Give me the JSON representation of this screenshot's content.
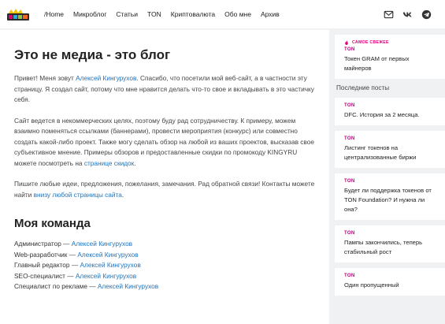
{
  "header": {
    "nav": [
      "/Home",
      "Микроблог",
      "Статьи",
      "TON",
      "Криптовалюта",
      "Обо мне",
      "Архив"
    ],
    "icons": [
      "mail-icon",
      "vk-icon",
      "telegram-icon"
    ]
  },
  "main": {
    "title": "Это не медиа - это блог",
    "para1": {
      "before": "Привет! Меня зовут ",
      "link": "Алексей Кингурухов",
      "after": ". Спасибо, что посетили мой веб-сайт, а в частности эту страницу. Я создал сайт, потому что мне нравится делать что-то свое и вкладывать в это частичку себя."
    },
    "para2": {
      "before": "Сайт ведется в некоммерческих целях, поэтому буду рад сотрудничеству. К примеру, можем взаимно поменяться ссылками (баннерами), провести мероприятия (конкурс) или совместно создать какой-либо проект. Также могу сделать обзор на любой из ваших проектов, высказав свое субъективное мнение. Примеры обзоров и предоставленные скидки по промокоду KINGYRU можете посмотреть на ",
      "link": "странице скидок",
      "after": "."
    },
    "para3": {
      "before": "Пишите любые идеи, предложения, пожелания, замечания. Рад обратной связи! Контакты можете найти ",
      "link": "внизу любой страницы сайта",
      "after": "."
    },
    "team_title": "Моя команда",
    "team": [
      {
        "role": "Администратор",
        "name": "Алексей Кингурухов"
      },
      {
        "role": "Web-разработчик",
        "name": "Алексей Кингурухов"
      },
      {
        "role": "Главный редактор",
        "name": "Алексей Кингурухов"
      },
      {
        "role": "SEO-специалист",
        "name": "Алексей Кингурухов"
      },
      {
        "role": "Специалист по рекламе",
        "name": "Алексей Кингурухов"
      }
    ],
    "dash": " — "
  },
  "sidebar": {
    "featured": {
      "badge": "САМОЕ СВЕЖЕЕ",
      "category": "TON",
      "title": "Токен GRAM от первых майнеров"
    },
    "recent_label": "Последние посты",
    "posts": [
      {
        "category": "TON",
        "title": "DFC. История за 2 месяца."
      },
      {
        "category": "TON",
        "title": "Листинг токенов на централизованные биржи"
      },
      {
        "category": "TON",
        "title": "Будет ли поддержка токенов от TON Foundation? И нужна ли она?"
      },
      {
        "category": "TON",
        "title": "Пампы закончились, теперь стабильный рост"
      },
      {
        "category": "TON",
        "title": "Один пропущенный"
      }
    ]
  },
  "colors": {
    "accent": "#1e73be",
    "category": "#b5007a",
    "badge": "#e0007a"
  }
}
